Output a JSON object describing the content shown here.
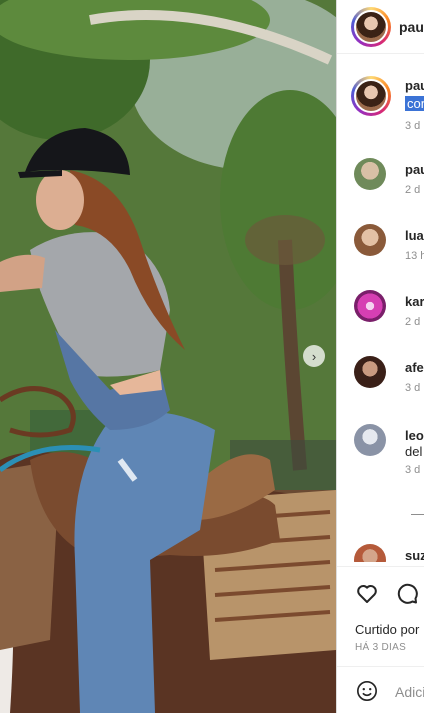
{
  "post": {
    "image_alt": "Woman in riding helmet and denim overalls sitting on a saddled horse",
    "author": "pau"
  },
  "comments": [
    {
      "name": "pau",
      "text": "con",
      "time": "3 d",
      "avatar_color": "#b98a6a"
    },
    {
      "name": "pau",
      "text": "",
      "time": "2 d",
      "avatar_color": "#8aa37a"
    },
    {
      "name": "lua",
      "text": "",
      "time": "13 h",
      "avatar_color": "#c8a07e"
    },
    {
      "name": "kar",
      "text": "",
      "time": "2 d",
      "avatar_color": "#d63fb3"
    },
    {
      "name": "afe",
      "text": "",
      "time": "3 d",
      "avatar_color": "#5a3a2e"
    },
    {
      "name": "leo",
      "text": "del",
      "time": "3 d",
      "avatar_color": "#a9b4c6"
    },
    {
      "name": "suz",
      "text": "",
      "time": "",
      "avatar_color": "#b55a3a"
    }
  ],
  "footer": {
    "likes_text": "Curtido por",
    "time_ago": "HÁ 3 DIAS",
    "add_comment_placeholder": "Adici"
  },
  "icons": {
    "like": "heart-icon",
    "comment": "comment-icon",
    "emoji": "emoji-icon",
    "next": "chevron-right-icon"
  }
}
